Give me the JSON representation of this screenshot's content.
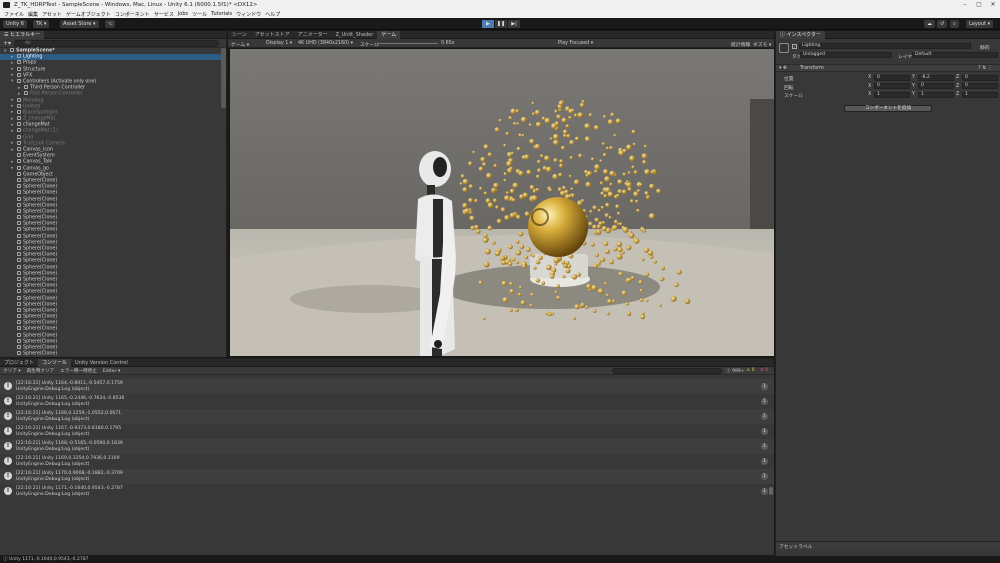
{
  "window": {
    "title": "Z_TK_HDRPTest - SampleScene - Windows, Mac, Linux - Unity 6.1 (6000.1.5f1)* <DX12>"
  },
  "menu": [
    "ファイル",
    "編集",
    "アセット",
    "ゲームオブジェクト",
    "コンポーネント",
    "サービス",
    "Jobs",
    "ツール",
    "Tutorials",
    "ウィンドウ",
    "ヘルプ"
  ],
  "toolbar": {
    "unity_label": "Unity 6",
    "account_label": "TK ▾",
    "asset_store_label": "Asset Store ▾",
    "layout_label": "Layout ▾"
  },
  "hierarchy": {
    "tab_label": "ヒエラルキー",
    "search_placeholder": "All",
    "scene_name": "SampleScene*",
    "items": [
      {
        "label": "Lighting",
        "state": "selected",
        "indent": 1,
        "arrow": "▸"
      },
      {
        "label": "Props",
        "state": "normal",
        "indent": 1,
        "arrow": "▸"
      },
      {
        "label": "Structure",
        "state": "normal",
        "indent": 1,
        "arrow": "▸"
      },
      {
        "label": "VFX",
        "state": "normal",
        "indent": 1,
        "arrow": "▸"
      },
      {
        "label": "Controllers (Activate only one)",
        "state": "normal",
        "indent": 1,
        "arrow": "▾"
      },
      {
        "label": "Third Person Controller",
        "state": "normal",
        "indent": 2,
        "arrow": "▸"
      },
      {
        "label": "First Person Controller",
        "state": "dim",
        "indent": 2,
        "arrow": "▸"
      },
      {
        "label": "Monolog",
        "state": "dim",
        "indent": 1,
        "arrow": "▸"
      },
      {
        "label": "Unlited",
        "state": "dim",
        "indent": 1,
        "arrow": "▸"
      },
      {
        "label": "BlackSpotlight",
        "state": "dim",
        "indent": 1,
        "arrow": "▸"
      },
      {
        "label": "Z_changeMat",
        "state": "dim",
        "indent": 1,
        "arrow": "▸"
      },
      {
        "label": "changeMat",
        "state": "normal",
        "indent": 1,
        "arrow": "▸"
      },
      {
        "label": "changeMat (1)",
        "state": "dim",
        "indent": 1,
        "arrow": "▸"
      },
      {
        "label": "Grid",
        "state": "dim",
        "indent": 1,
        "arrow": ""
      },
      {
        "label": "TrueLook Camera",
        "state": "dim",
        "indent": 1,
        "arrow": "▸"
      },
      {
        "label": "Canvas_icon",
        "state": "normal",
        "indent": 1,
        "arrow": "▸"
      },
      {
        "label": "EventSystem",
        "state": "normal",
        "indent": 1,
        "arrow": ""
      },
      {
        "label": "Canvas_Talk",
        "state": "normal",
        "indent": 1,
        "arrow": "▸"
      },
      {
        "label": "Canvas_go",
        "state": "normal",
        "indent": 1,
        "arrow": "▸"
      },
      {
        "label": "GameObject",
        "state": "normal",
        "indent": 1,
        "arrow": ""
      },
      {
        "label": "Sphere(Clone)",
        "state": "normal",
        "indent": 1,
        "arrow": ""
      },
      {
        "label": "Sphere(Clone)",
        "state": "normal",
        "indent": 1,
        "arrow": ""
      },
      {
        "label": "Sphere(Clone)",
        "state": "normal",
        "indent": 1,
        "arrow": ""
      },
      {
        "label": "Sphere(Clone)",
        "state": "normal",
        "indent": 1,
        "arrow": ""
      },
      {
        "label": "Sphere(Clone)",
        "state": "normal",
        "indent": 1,
        "arrow": ""
      },
      {
        "label": "Sphere(Clone)",
        "state": "normal",
        "indent": 1,
        "arrow": ""
      },
      {
        "label": "Sphere(Clone)",
        "state": "normal",
        "indent": 1,
        "arrow": ""
      },
      {
        "label": "Sphere(Clone)",
        "state": "normal",
        "indent": 1,
        "arrow": ""
      },
      {
        "label": "Sphere(Clone)",
        "state": "normal",
        "indent": 1,
        "arrow": ""
      },
      {
        "label": "Sphere(Clone)",
        "state": "normal",
        "indent": 1,
        "arrow": ""
      },
      {
        "label": "Sphere(Clone)",
        "state": "normal",
        "indent": 1,
        "arrow": ""
      },
      {
        "label": "Sphere(Clone)",
        "state": "normal",
        "indent": 1,
        "arrow": ""
      },
      {
        "label": "Sphere(Clone)",
        "state": "normal",
        "indent": 1,
        "arrow": ""
      },
      {
        "label": "Sphere(Clone)",
        "state": "normal",
        "indent": 1,
        "arrow": ""
      },
      {
        "label": "Sphere(Clone)",
        "state": "normal",
        "indent": 1,
        "arrow": ""
      },
      {
        "label": "Sphere(Clone)",
        "state": "normal",
        "indent": 1,
        "arrow": ""
      },
      {
        "label": "Sphere(Clone)",
        "state": "normal",
        "indent": 1,
        "arrow": ""
      },
      {
        "label": "Sphere(Clone)",
        "state": "normal",
        "indent": 1,
        "arrow": ""
      },
      {
        "label": "Sphere(Clone)",
        "state": "normal",
        "indent": 1,
        "arrow": ""
      },
      {
        "label": "Sphere(Clone)",
        "state": "normal",
        "indent": 1,
        "arrow": ""
      },
      {
        "label": "Sphere(Clone)",
        "state": "normal",
        "indent": 1,
        "arrow": ""
      },
      {
        "label": "Sphere(Clone)",
        "state": "normal",
        "indent": 1,
        "arrow": ""
      },
      {
        "label": "Sphere(Clone)",
        "state": "normal",
        "indent": 1,
        "arrow": ""
      },
      {
        "label": "Sphere(Clone)",
        "state": "normal",
        "indent": 1,
        "arrow": ""
      },
      {
        "label": "Sphere(Clone)",
        "state": "normal",
        "indent": 1,
        "arrow": ""
      },
      {
        "label": "Sphere(Clone)",
        "state": "normal",
        "indent": 1,
        "arrow": ""
      },
      {
        "label": "Sphere(Clone)",
        "state": "normal",
        "indent": 1,
        "arrow": ""
      },
      {
        "label": "Sphere(Clone)",
        "state": "normal",
        "indent": 1,
        "arrow": ""
      },
      {
        "label": "Sphere(Clone)",
        "state": "normal",
        "indent": 1,
        "arrow": ""
      }
    ]
  },
  "scene_tabs": [
    {
      "label": "シーン",
      "active": false
    },
    {
      "label": "アセットストア",
      "active": false
    },
    {
      "label": "アニメーター",
      "active": false
    },
    {
      "label": "Z_Unlit_Shader",
      "active": false
    },
    {
      "label": "ゲーム",
      "active": true
    }
  ],
  "game_controls": {
    "mode": "ゲーム ▾",
    "display": "Display 1 ▾",
    "resolution": "4K UHD (3840x2160) ▾",
    "scale_label": "スケール",
    "scale_value": "0.65x",
    "play_focused": "Play Focused ▾",
    "stats": "統計情報",
    "gizmos": "ギズモ ▾"
  },
  "inspector": {
    "tab_label": "インスペクター",
    "object_name": "Lighting",
    "static_label": "静的",
    "tag_label": "タグ",
    "tag_value": "Untagged",
    "layer_label": "レイヤー",
    "layer_value": "Default",
    "component": "Transform",
    "rows": [
      {
        "label": "位置",
        "x": "0",
        "y": "-8.2",
        "z": "0"
      },
      {
        "label": "回転",
        "x": "0",
        "y": "0",
        "z": "0"
      },
      {
        "label": "スケール",
        "x": "1",
        "y": "1",
        "z": "1"
      }
    ],
    "add_component": "コンポーネントを追加",
    "asset_labels": "アセットラベル"
  },
  "bottom_tabs": [
    {
      "label": "プロジェクト",
      "active": false
    },
    {
      "label": "コンソール",
      "active": true
    },
    {
      "label": "Unity Version Control",
      "active": false
    }
  ],
  "console": {
    "buttons": [
      "クリア ▾",
      "再生時クリア",
      "エラー時一時停止",
      "Editor ▾"
    ],
    "counts": {
      "log": "999+",
      "warn": "0",
      "error": "0"
    },
    "entries": [
      {
        "line1": "[22:16:21] Unity 1164,-0.8011,-0.5457,0.1759",
        "line2": "UnityEngine.Debug:Log (object)",
        "count": "1"
      },
      {
        "line1": "[22:16:21] Unity 1165,-0.2446,-0.7634,-0.8536",
        "line2": "UnityEngine.Debug:Log (object)",
        "count": "1"
      },
      {
        "line1": "[22:16:21] Unity 1166,0.1259,-1.0552,0.0671",
        "line2": "UnityEngine.Debug:Log (object)",
        "count": "1"
      },
      {
        "line1": "[22:16:21] Unity 1167,-0.9373,0.8180,0.1795",
        "line2": "UnityEngine.Debug:Log (object)",
        "count": "1"
      },
      {
        "line1": "[22:16:21] Unity 1168,-0.5165,-0.0590,0.1839",
        "line2": "UnityEngine.Debug:Log (object)",
        "count": "1"
      },
      {
        "line1": "[22:16:21] Unity 1169,0.3354,0.7936,0.3109",
        "line2": "UnityEngine.Debug:Log (object)",
        "count": "1"
      },
      {
        "line1": "[22:16:21] Unity 1170,0.9008,-0.1882,-0.3709",
        "line2": "UnityEngine.Debug:Log (object)",
        "count": "1"
      },
      {
        "line1": "[22:16:21] Unity 1171,-0.1640,0.9543,-0.2787",
        "line2": "UnityEngine.Debug:Log (object)",
        "count": "1"
      }
    ]
  },
  "status": {
    "text": "Unity 1171,-0.1640,0.9543,-0.2787"
  },
  "colors": {
    "selection": "#2c5d87",
    "panel": "#383838",
    "gold": "#c9a227"
  }
}
